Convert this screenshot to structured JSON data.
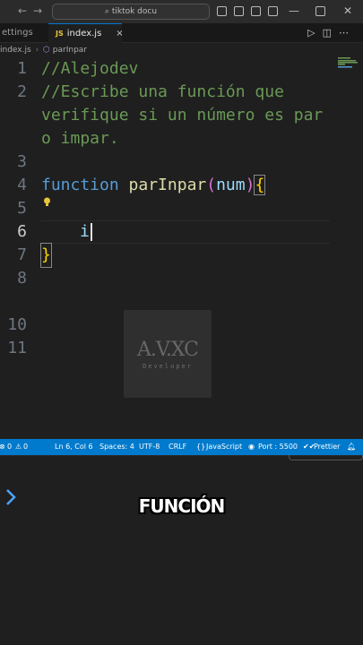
{
  "titlebar": {
    "back": "←",
    "forward": "→",
    "search_text": "tiktok docu"
  },
  "tabs": [
    {
      "label": "ettings"
    },
    {
      "label": "index.js",
      "icon": "JS",
      "close": "×"
    }
  ],
  "breadcrumb": {
    "file": "index.js",
    "symbol": "parInpar"
  },
  "editor": {
    "line_numbers": [
      "1",
      "2",
      "",
      "",
      "3",
      "4",
      "5",
      "6",
      "7",
      "8",
      "10",
      "11"
    ],
    "lines": {
      "l1": "//Alejodev",
      "l2": "//Escribe una función que",
      "l2b": "verifique si un número es par",
      "l2c": "o impar.",
      "kw": "function",
      "fname": "parInpar",
      "open_paren": "(",
      "param": "num",
      "close_paren": ")",
      "open_brace": "{",
      "l6": "i",
      "close_brace": "}"
    }
  },
  "watermark": {
    "main": "A.V.XC",
    "sub": "Developer"
  },
  "statusbar": {
    "errors": "0",
    "warnings": "0",
    "position": "Ln 6, Col 6",
    "spaces": "Spaces: 4",
    "encoding": "UTF-8",
    "eol": "CRLF",
    "language": "JavaScript",
    "port": "Port : 5500",
    "formatter": "Prettier"
  },
  "caption": "FUNCIÓN",
  "colors": {
    "accent": "#007acc",
    "comment": "#6a9955",
    "keyword": "#569cd6",
    "function": "#dcdcaa"
  }
}
